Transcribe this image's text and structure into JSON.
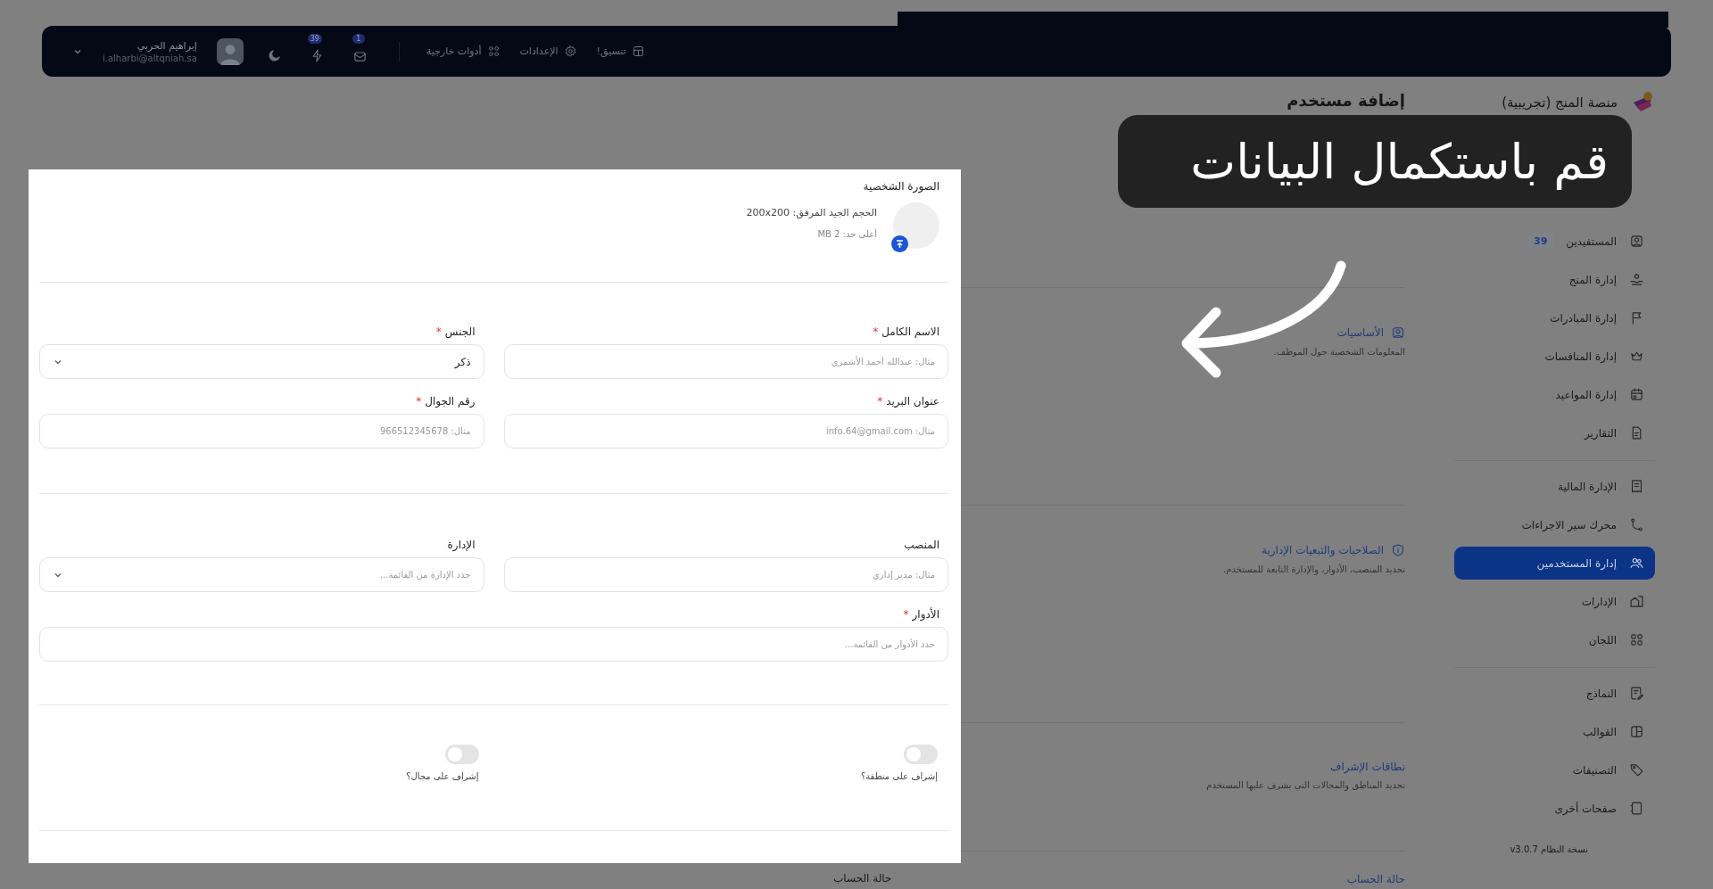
{
  "top_bar": {
    "user": {
      "name": "إبراهيم الحربي",
      "email": "i.alharbi@altqniah.sa"
    },
    "notifications": [
      {
        "badge": "1"
      },
      {
        "badge": "39"
      }
    ],
    "links": [
      {
        "label": "تنسيق!"
      },
      {
        "label": "الإعدادات"
      },
      {
        "label": "أدوات خارجية"
      }
    ]
  },
  "sidebar": {
    "brand": "منصة المنج (تجريبية)",
    "groups": [
      {
        "items": [
          {
            "label": "المستفيدين",
            "badge": "39",
            "selected": false
          },
          {
            "label": "إدارة المنح",
            "selected": false
          },
          {
            "label": "إدارة المبادرات",
            "selected": false
          },
          {
            "label": "إدارة المنافسات",
            "selected": false
          },
          {
            "label": "إدارة المواعيد",
            "selected": false
          },
          {
            "label": "التقارير",
            "selected": false
          }
        ]
      },
      {
        "items": [
          {
            "label": "الإدارة المالية",
            "selected": false
          },
          {
            "label": "محرك سير الاجراءات",
            "selected": false
          },
          {
            "label": "إدارة المستخدمين",
            "selected": true
          },
          {
            "label": "الإدارات",
            "selected": false
          },
          {
            "label": "اللجان",
            "selected": false
          }
        ]
      },
      {
        "items": [
          {
            "label": "النماذج",
            "selected": false
          },
          {
            "label": "القوالب",
            "selected": false
          },
          {
            "label": "التصنيفات",
            "selected": false
          },
          {
            "label": "صفحات أخرى",
            "selected": false
          }
        ]
      }
    ],
    "version": "نسخة النظام v3.0.7"
  },
  "page": {
    "title": "إضافة مستخدم",
    "sections": [
      {
        "title": "الأساسيات",
        "subtitle": "المعلومات الشخصية حول الموظف.",
        "kind": "person"
      },
      {
        "title": "الصلاحيات والتبعيات الإدارية",
        "subtitle": "تحديد المنصب، الأدوار، والإدارة التابعة للمستخدم.",
        "kind": "shield"
      },
      {
        "title": "نطاقات الإشراف",
        "subtitle": "تحديد المناطق والمجالات التي يشرف عليها المستخدم",
        "kind": "plain"
      },
      {
        "title": "حالة الحساب",
        "kind": "plain"
      }
    ],
    "next_field_label": "حالة الحساب"
  },
  "form_panel": {
    "photo": {
      "label": "الصورة الشخصية",
      "size_hint": "الحجم الجيد المرفق: 200x200",
      "limit_hint": "أعلى حد: 2 MB"
    },
    "groups": [
      {
        "rows": [
          [
            {
              "kind": "text",
              "label": "الاسم الكامل",
              "required_mark": "*",
              "placeholder": "مثال: عبدالله أحمد الأشمري"
            },
            {
              "kind": "select",
              "label": "الجنس",
              "required_mark": "*",
              "value": "ذكر"
            }
          ],
          [
            {
              "kind": "text",
              "label": "عنوان البريد",
              "required_mark": "*",
              "placeholder": "مثال: info.64@gmail.com"
            },
            {
              "kind": "text",
              "label": "رقم الجوال",
              "required_mark": "*",
              "placeholder": "مثال: 966512345678"
            }
          ]
        ]
      },
      {
        "rows": [
          [
            {
              "kind": "text",
              "label": "المنصب",
              "placeholder": "مثال: مدير إداري"
            },
            {
              "kind": "select",
              "label": "الإدارة",
              "placeholder": "حدد الإدارة من القائمة..."
            }
          ],
          [
            {
              "kind": "text",
              "label": "الأدوار",
              "required_mark": "*",
              "placeholder": "حدد الأدوار من القائمة..."
            }
          ]
        ]
      }
    ],
    "toggles": [
      {
        "label": "إشراف على منطقة؟",
        "on": false
      },
      {
        "label": "إشراف على مجال؟",
        "on": false
      }
    ]
  },
  "callout": {
    "text": "قم باستكمال البيانات"
  }
}
